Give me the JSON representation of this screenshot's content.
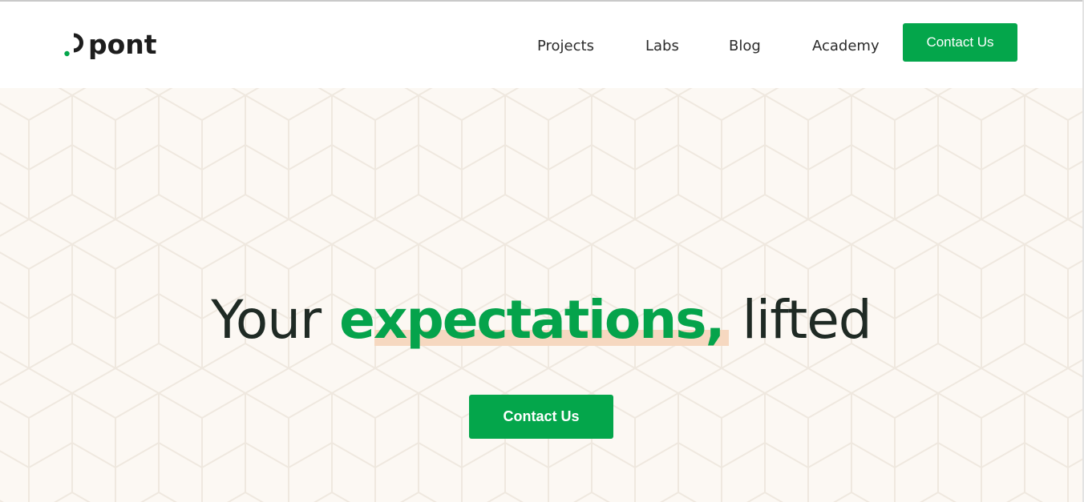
{
  "brand": {
    "name": "pont",
    "accent_color": "#04a64b",
    "dot_color": "#04a64b"
  },
  "nav": {
    "items": [
      {
        "label": "Projects"
      },
      {
        "label": "Labs"
      },
      {
        "label": "Blog"
      },
      {
        "label": "Academy"
      }
    ],
    "cta_label": "Contact Us"
  },
  "hero": {
    "headline_start": "Your",
    "headline_accent": "expectations,",
    "headline_end": "lifted",
    "cta_label": "Contact Us",
    "background_color": "#fcf8f3",
    "highlight_color": "#f6d8c0"
  }
}
